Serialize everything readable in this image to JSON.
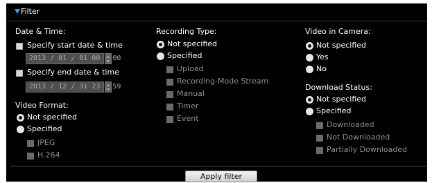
{
  "filter": {
    "title": "Filter",
    "apply_button": "Apply filter",
    "date_time": {
      "heading": "Date & Time:",
      "start_label": "Specify start date & time",
      "start_value": "2013 / 01 / 01 00 : 00",
      "end_label": "Specify end date & time",
      "end_value": "2013 / 12 / 31 23 : 59"
    },
    "video_format": {
      "heading": "Video Format:",
      "not_specified": "Not specified",
      "specified": "Specified",
      "options": [
        "JPEG",
        "H.264"
      ]
    },
    "recording_type": {
      "heading": "Recording Type:",
      "not_specified": "Not specified",
      "specified": "Specified",
      "options": [
        "Upload",
        "Recording-Mode Stream",
        "Manual",
        "Timer",
        "Event"
      ]
    },
    "video_in_camera": {
      "heading": "Video in Camera:",
      "options": [
        "Not specified",
        "Yes",
        "No"
      ]
    },
    "download_status": {
      "heading": "Download Status:",
      "not_specified": "Not specified",
      "specified": "Specified",
      "options": [
        "Downloaded",
        "Not Downloaded",
        "Partially Downloaded"
      ]
    }
  },
  "colors": {
    "background": "#000000",
    "accent": "#3aa3f5",
    "text": "#ffffff",
    "disabled_text": "#8f8f8f"
  }
}
